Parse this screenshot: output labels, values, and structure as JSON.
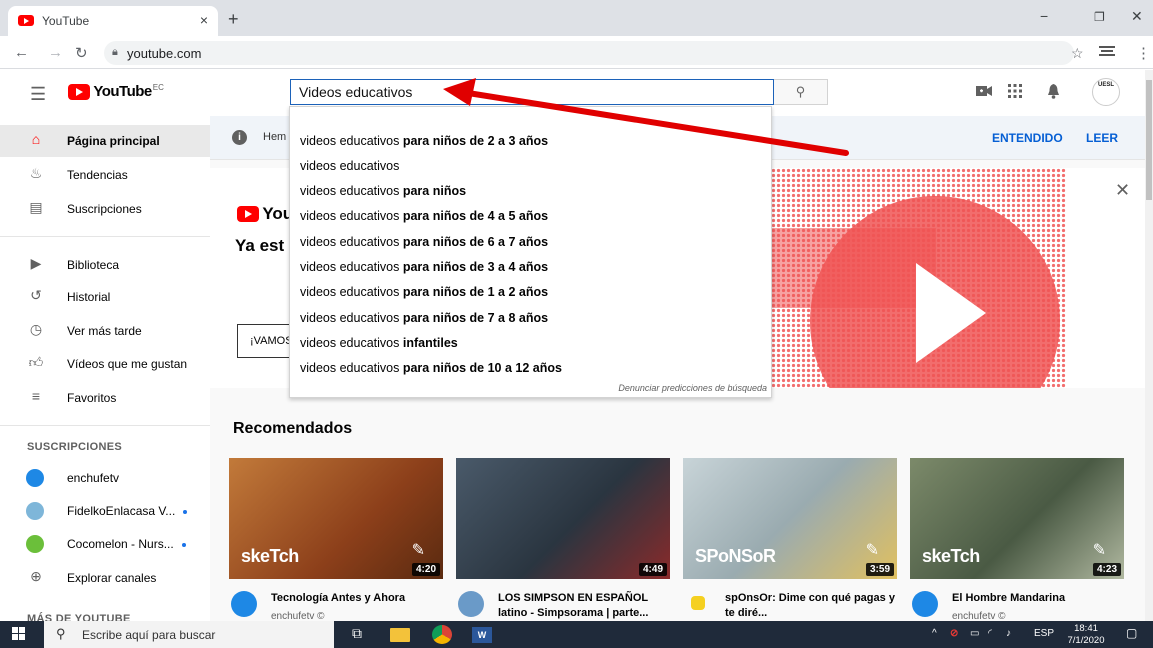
{
  "browser": {
    "tab_title": "YouTube",
    "url": "youtube.com",
    "tab_close_glyph": "×",
    "new_tab_glyph": "+",
    "window_controls": [
      "−",
      "❐",
      "✕"
    ]
  },
  "masthead": {
    "logo_text": "YouTube",
    "country_code": "EC",
    "search_value": "Videos educativos",
    "avatar_text": "UESL"
  },
  "sidebar": {
    "main_items": [
      {
        "label": "Página principal",
        "icon": "home-icon"
      },
      {
        "label": "Tendencias",
        "icon": "trending-icon"
      },
      {
        "label": "Suscripciones",
        "icon": "subscriptions-icon"
      }
    ],
    "library_items": [
      {
        "label": "Biblioteca",
        "icon": "library-icon"
      },
      {
        "label": "Historial",
        "icon": "history-icon"
      },
      {
        "label": "Ver más tarde",
        "icon": "watch-later-icon"
      },
      {
        "label": "Vídeos que me gustan",
        "icon": "like-icon"
      },
      {
        "label": "Favoritos",
        "icon": "playlist-icon"
      }
    ],
    "subscriptions_heading": "SUSCRIPCIONES",
    "subscriptions": [
      {
        "label": "enchufetv",
        "color": "#1e88e5",
        "new": false
      },
      {
        "label": "FidelkoEnlacasa V...",
        "color": "#7eb6d9",
        "new": true
      },
      {
        "label": "Cocomelon - Nurs...",
        "color": "#6bbf3a",
        "new": true
      }
    ],
    "explore_label": "Explorar canales",
    "more_heading": "MÁS DE YOUTUBE"
  },
  "infobar": {
    "text": "Hem",
    "accept": "ENTENDIDO",
    "read": "LEER"
  },
  "banner": {
    "logo_text": "You",
    "title": "Ya est",
    "button": "¡VAMOS"
  },
  "suggestions": {
    "items": [
      {
        "base": "videos educativos",
        "rest": " para niños de 2 a 3 años"
      },
      {
        "base": "videos educativos",
        "rest": ""
      },
      {
        "base": "videos educativos",
        "rest": " para niños"
      },
      {
        "base": "videos educativos",
        "rest": " para niños de 4 a 5 años"
      },
      {
        "base": "videos educativos",
        "rest": " para niños de 6 a 7 años"
      },
      {
        "base": "videos educativos",
        "rest": " para niños de 3 a 4 años"
      },
      {
        "base": "videos educativos",
        "rest": " para niños de 1 a 2 años"
      },
      {
        "base": "videos educativos",
        "rest": " para niños de 7 a 8 años"
      },
      {
        "base": "videos educativos",
        "rest": " infantiles"
      },
      {
        "base": "videos educativos",
        "rest": " para niños de 10 a 12 años"
      }
    ],
    "report": "Denunciar predicciones de búsqueda"
  },
  "recommended": {
    "heading": "Recomendados",
    "videos": [
      {
        "title": "Tecnología Antes y Ahora",
        "channel": "enchufetv ©",
        "duration": "4:20",
        "brand": "skeTch",
        "bg": "#a85a2a"
      },
      {
        "title": "LOS SIMPSON EN ESPAÑOL latino - Simpsorama | parte...",
        "channel": "",
        "duration": "4:49",
        "brand": "",
        "bg": "#3a4a5a"
      },
      {
        "title": "spOnsOr: Dime con qué pagas y te diré...",
        "channel": "",
        "duration": "3:59",
        "brand": "SPoNSoR",
        "bg": "#8fa0a8"
      },
      {
        "title": "El Hombre Mandarina",
        "channel": "enchufetv ©",
        "duration": "4:23",
        "brand": "skeTch",
        "bg": "#6a7a5a"
      }
    ]
  },
  "taskbar": {
    "search_placeholder": "Escribe aquí para buscar",
    "lang": "ESP",
    "time": "18:41",
    "date": "7/1/2020"
  },
  "colors": {
    "youtube_red": "#ff0000",
    "link_blue": "#065fd4",
    "annotation_arrow": "#e00000"
  }
}
